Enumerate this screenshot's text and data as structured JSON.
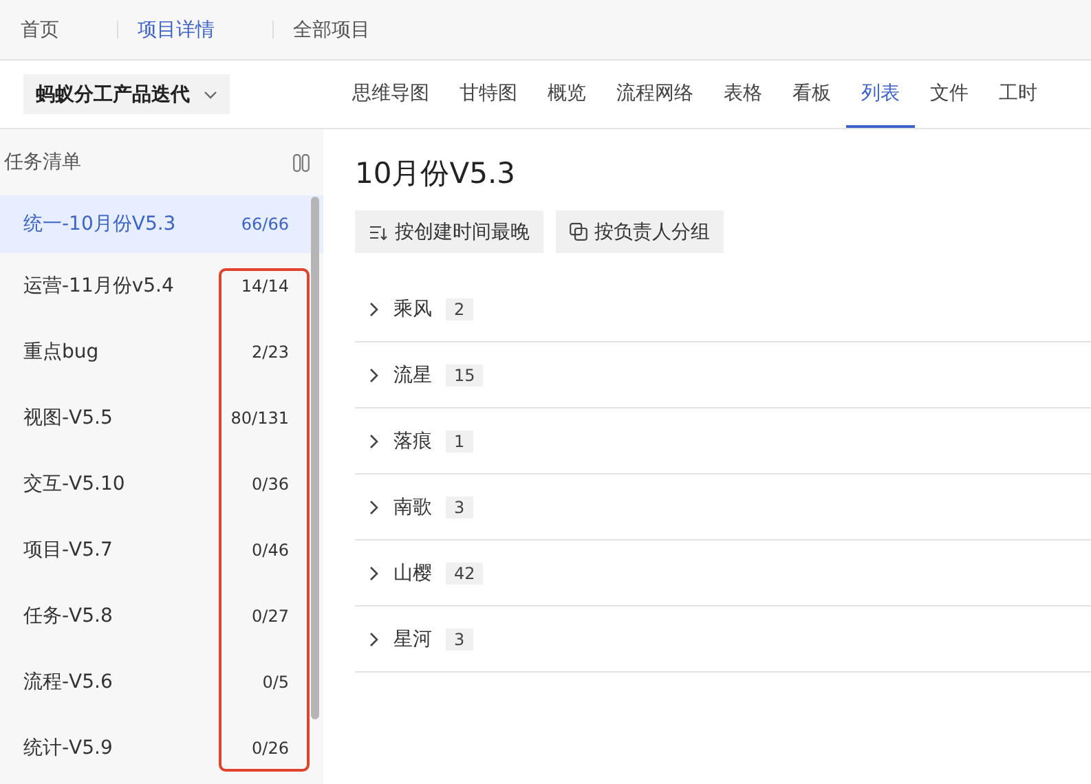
{
  "breadcrumbs": [
    {
      "label": "首页",
      "selected": false
    },
    {
      "label": "项目详情",
      "selected": true
    },
    {
      "label": "全部项目",
      "selected": false
    }
  ],
  "project": {
    "name": "蚂蚁分工产品迭代"
  },
  "tabs": [
    {
      "label": "思维导图",
      "selected": false
    },
    {
      "label": "甘特图",
      "selected": false
    },
    {
      "label": "概览",
      "selected": false
    },
    {
      "label": "流程网络",
      "selected": false
    },
    {
      "label": "表格",
      "selected": false
    },
    {
      "label": "看板",
      "selected": false
    },
    {
      "label": "列表",
      "selected": true
    },
    {
      "label": "文件",
      "selected": false
    },
    {
      "label": "工时",
      "selected": false
    }
  ],
  "sidebar": {
    "title": "任务清单",
    "items": [
      {
        "name": "统一-10月份V5.3",
        "count": "66/66",
        "selected": true
      },
      {
        "name": "运营-11月份v5.4",
        "count": "14/14",
        "selected": false
      },
      {
        "name": "重点bug",
        "count": "2/23",
        "selected": false
      },
      {
        "name": "视图-V5.5",
        "count": "80/131",
        "selected": false
      },
      {
        "name": "交互-V5.10",
        "count": "0/36",
        "selected": false
      },
      {
        "name": "项目-V5.7",
        "count": "0/46",
        "selected": false
      },
      {
        "name": "任务-V5.8",
        "count": "0/27",
        "selected": false
      },
      {
        "name": "流程-V5.6",
        "count": "0/5",
        "selected": false
      },
      {
        "name": "统计-V5.9",
        "count": "0/26",
        "selected": false
      }
    ]
  },
  "main": {
    "title": "10月份V5.3",
    "sort_button": "按创建时间最晚",
    "group_button": "按负责人分组",
    "groups": [
      {
        "name": "乘风",
        "count": "2",
        "expanded": false
      },
      {
        "name": "流星",
        "count": "15",
        "expanded": false
      },
      {
        "name": "落痕",
        "count": "1",
        "expanded": false
      },
      {
        "name": "南歌",
        "count": "3",
        "expanded": false
      },
      {
        "name": "山樱",
        "count": "42",
        "expanded": false
      },
      {
        "name": "星河",
        "count": "3",
        "expanded": false
      }
    ]
  }
}
